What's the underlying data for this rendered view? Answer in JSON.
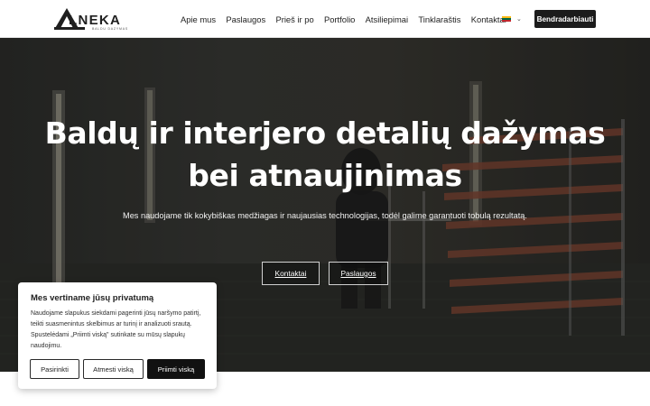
{
  "header": {
    "logo_text": "LNEKA",
    "logo_subtext": "BALDU DAZYMAS",
    "nav": [
      "Apie mus",
      "Paslaugos",
      "Prieš ir po",
      "Portfolio",
      "Atsiliepimai",
      "Tinklaraštis",
      "Kontaktai"
    ],
    "language_flag": [
      "#fdb913",
      "#006a44",
      "#c1272d"
    ],
    "cta_label": "Bendradarbiauti"
  },
  "hero": {
    "title": "Baldų ir interjero detalių dažymas bei atnaujinimas",
    "subtitle": "Mes naudojame tik kokybiškas medžiagas ir naujausias technologijas, todėl galime garantuoti tobulą rezultatą.",
    "buttons": [
      "Kontaktai",
      "Paslaugos"
    ]
  },
  "cookie": {
    "title": "Mes vertiname jūsų privatumą",
    "text": "Naudojame slapukus siekdami pagerinti jūsų naršymo patirtį, teikti suasmenintus skelbimus ar turinį ir analizuoti srautą. Spustelėdami „Priimti viską\" sutinkate su mūsų slapukų naudojimu.",
    "customize_label": "Pasirinkti",
    "reject_label": "Atmesti viską",
    "accept_label": "Priimti viską"
  }
}
